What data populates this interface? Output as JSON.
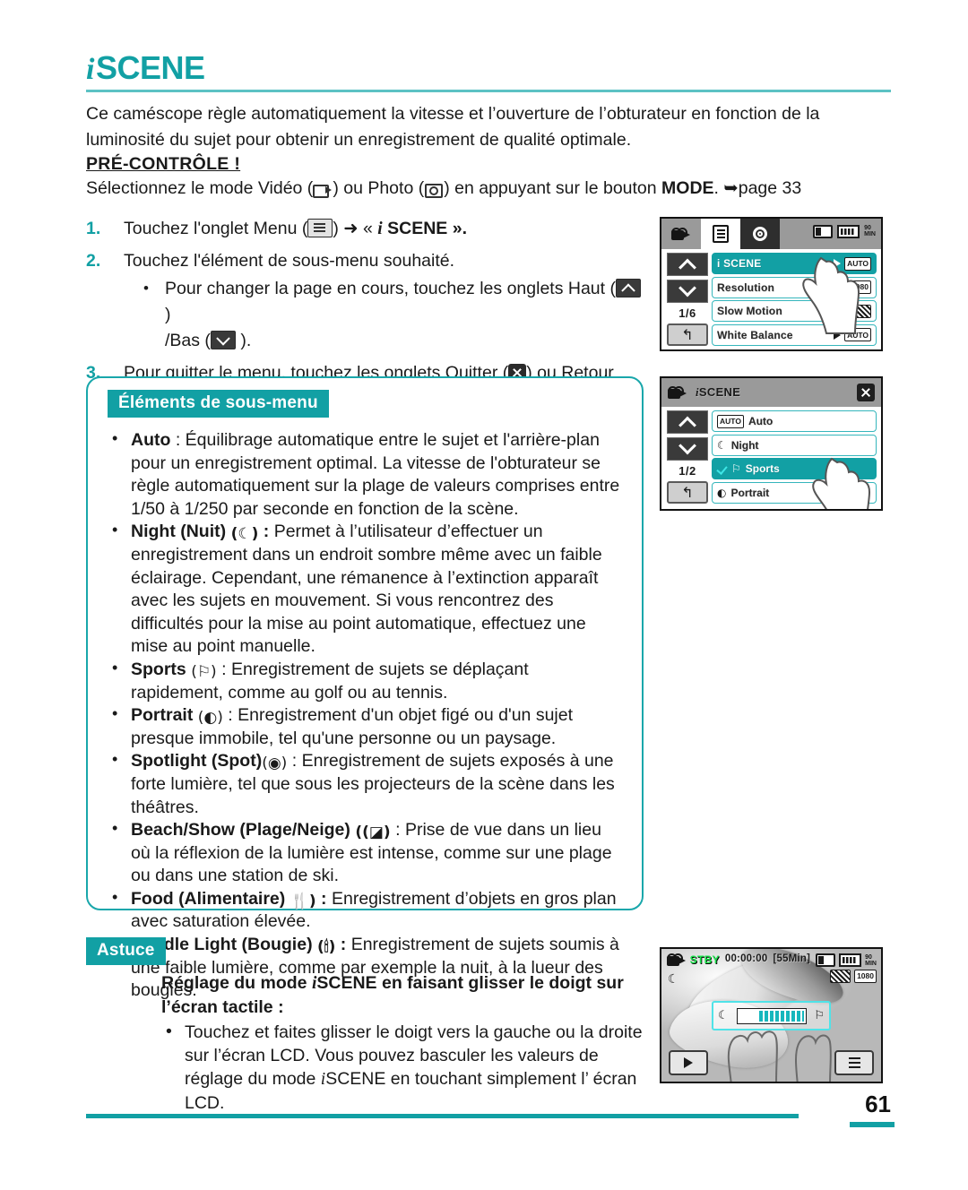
{
  "header": {
    "title_i": "i",
    "title_text": "SCENE"
  },
  "intro": {
    "paragraph": "Ce caméscope règle automatiquement la vitesse et l’ouverture de l’obturateur en fonction de la luminosité du sujet pour obtenir un enregistrement de qualité optimale.",
    "precheck_label": "PRÉ-CONTRÔLE !",
    "select_prefix": "Sélectionnez le mode Vidéo (",
    "select_mid": ") ou Photo (",
    "select_suffix": ") en appuyant sur le bouton ",
    "mode_word": "MODE",
    "page_ref": ". ➥page 33"
  },
  "steps": [
    {
      "num": "1.",
      "text_before": "Touchez l'onglet Menu (",
      "text_after": ") ➜ « ",
      "emphasis_i": "i",
      "emphasis": " SCENE »."
    },
    {
      "num": "2.",
      "text": "Touchez l'élément de sous-menu souhaité.",
      "sub_before": "Pour changer la page en cours, touchez les onglets Haut (",
      "sub_mid": " )",
      "sub_line2_before": "/Bas (",
      "sub_line2_after": " )."
    },
    {
      "num": "3.",
      "text_before": "Pour quitter le menu, touchez les onglets Quitter (",
      "text_mid": ") ou Retour",
      "text_after": "(",
      "text_end": ")."
    }
  ],
  "submenu": {
    "badge": "Éléments de sous-menu",
    "items": [
      {
        "name": "Auto",
        "icon": "",
        "separator": " : ",
        "description": "Équilibrage automatique entre le sujet et l'arrière-plan pour un enregistrement optimal. La vitesse de l'obturateur se règle automatiquement sur la plage de valeurs comprises entre 1/50 à 1/250 par seconde en fonction de la scène."
      },
      {
        "name": "Night (Nuit)",
        "icon": "(☾)",
        "separator": " : ",
        "description": "Permet à l’utilisateur d’effectuer un enregistrement dans un endroit sombre même avec un faible éclairage. Cependant, une rémanence à l’extinction apparaît avec les sujets en mouvement. Si vous rencontrez des difficultés pour la mise au point automatique, effectuez une mise au point manuelle."
      },
      {
        "name": "Sports",
        "icon": "(⚐)",
        "separator": " : ",
        "description": "Enregistrement de sujets se déplaçant rapidement, comme au golf ou au tennis."
      },
      {
        "name": "Portrait",
        "icon": "(◐)",
        "separator": " : ",
        "description": "Enregistrement d'un objet figé ou d'un sujet presque immobile, tel qu'une personne ou un paysage."
      },
      {
        "name": "Spotlight (Spot)",
        "icon": "(◉)",
        "separator": " : ",
        "description": "Enregistrement de sujets exposés à une forte lumière, tel que sous les projecteurs de la scène dans les théâtres."
      },
      {
        "name": "Beach/Show (Plage/Neige)",
        "icon": "((◪)",
        "separator": " : ",
        "description": "Prise de vue dans un lieu où la réflexion de la lumière est intense, comme sur une plage ou dans une station de ski."
      },
      {
        "name": "Food (Alimentaire)",
        "icon": "🍴)",
        "separator": " : ",
        "description": "Enregistrement d’objets en gros plan avec saturation élevée."
      },
      {
        "name": "Candle Light (Bougie)",
        "icon": "(🕯)",
        "separator": " : ",
        "description": "Enregistrement de sujets soumis à une faible lumière, comme par exemple la nuit, à la lueur des bougies."
      }
    ]
  },
  "astuce": {
    "badge": "Astuce",
    "heading_part1": "Réglage du mode ",
    "heading_i": "i",
    "heading_part2": "SCENE en faisant glisser le doigt sur l’écran tactile :",
    "tip_part1": "Touchez et faites glisser le doigt vers la gauche ou la droite sur l’écran LCD. Vous pouvez basculer les valeurs de réglage du mode ",
    "tip_i": "i",
    "tip_part2": "SCENE en touchant simplement l’ écran LCD."
  },
  "lcd1": {
    "tabs": [
      "camcorder-tab",
      "menu-tab",
      "settings-tab"
    ],
    "battery_time": "90",
    "battery_unit": "MIN",
    "page_indicator": "1/6",
    "back_glyph": "↰",
    "rows": [
      {
        "label": "i SCENE",
        "selected": true,
        "has_arrow": true,
        "chip": "AUTO",
        "chip_style": "text"
      },
      {
        "label": "Resolution",
        "selected": false,
        "has_arrow": false,
        "chip": "1080",
        "chip_style": "text"
      },
      {
        "label": "Slow Motion",
        "selected": false,
        "has_arrow": true,
        "chip": "",
        "chip_style": "hatch"
      },
      {
        "label": "White Balance",
        "selected": false,
        "has_arrow": true,
        "chip": "AUTO",
        "chip_style": "text"
      }
    ]
  },
  "lcd2": {
    "title_i": "i",
    "title": "SCENE",
    "page_indicator": "1/2",
    "back_glyph": "↰",
    "options": [
      {
        "label": "Auto",
        "icon": "AUTO",
        "icon_type": "chip",
        "selected": false,
        "checked": false
      },
      {
        "label": "Night",
        "icon": "☾",
        "icon_type": "glyph",
        "selected": false,
        "checked": false
      },
      {
        "label": "Sports",
        "icon": "⚐",
        "icon_type": "glyph",
        "selected": true,
        "checked": true
      },
      {
        "label": "Portrait",
        "icon": "◐",
        "icon_type": "glyph",
        "selected": false,
        "checked": false
      }
    ]
  },
  "lcd3": {
    "status": "STBY",
    "timecode": "00:00:00",
    "remaining": "[55Min]",
    "battery_time": "90",
    "battery_unit": "MIN",
    "quality_chip": "SF",
    "resolution_chip": "1080",
    "night_icon": "☾",
    "slider_left_icon": "☾",
    "slider_right_icon": "⚐",
    "play_button": "play-icon",
    "menu_button": "menu-icon"
  },
  "footer": {
    "page_number": "61"
  },
  "colors": {
    "teal": "#12a0a4",
    "teal_light": "#5cc2c4",
    "lcd_border": "#35b6bc"
  }
}
